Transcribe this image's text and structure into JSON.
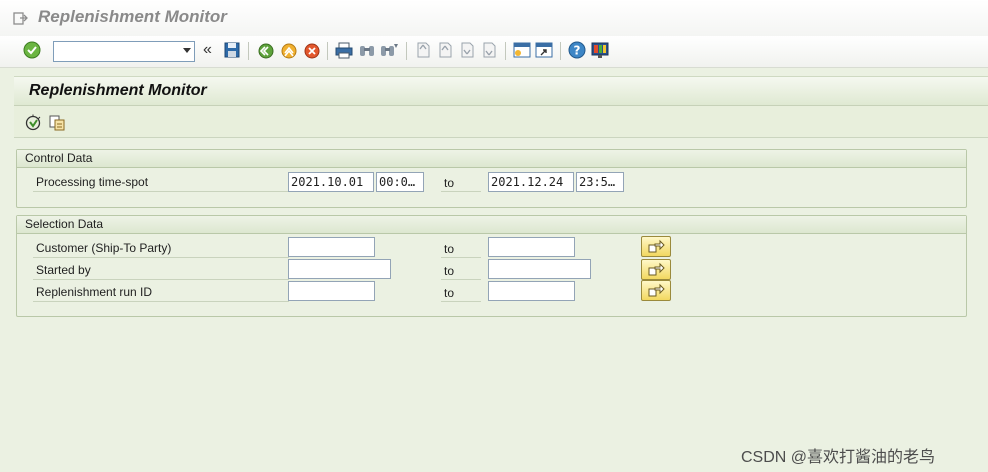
{
  "window": {
    "title": "Replenishment Monitor"
  },
  "toolbar": {
    "command_field": {
      "value": ""
    },
    "icons": [
      "enter-icon",
      "command-dropdown-icon",
      "collapse-icon",
      "save-icon",
      "back-icon",
      "exit-icon",
      "cancel-icon",
      "print-icon",
      "find-icon",
      "find-next-icon",
      "first-page-icon",
      "previous-page-icon",
      "next-page-icon",
      "last-page-icon",
      "create-session-icon",
      "shortcut-icon",
      "help-icon",
      "layout-icon"
    ]
  },
  "page": {
    "title": "Replenishment Monitor",
    "app_icons": [
      "execute-icon",
      "get-variant-icon"
    ]
  },
  "control": {
    "header": "Control Data",
    "rows": [
      {
        "label": "Processing time-spot",
        "from_date": "2021.10.01",
        "from_time": "00:0…",
        "to_label": "to",
        "to_date": "2021.12.24",
        "to_time": "23:5…"
      }
    ]
  },
  "selection": {
    "header": "Selection Data",
    "rows": [
      {
        "label": "Customer (Ship-To Party)",
        "from": "",
        "to_label": "to",
        "to": ""
      },
      {
        "label": "Started by",
        "from": "",
        "to_label": "to",
        "to": ""
      },
      {
        "label": "Replenishment run ID",
        "from": "",
        "to_label": "to",
        "to": ""
      }
    ]
  },
  "watermark": "CSDN @喜欢打酱油的老鸟",
  "colors": {
    "background": "#ebf1e2",
    "header": "#dfe9d2",
    "group_border": "#b9c8a8",
    "multi_button": "#f2d860"
  }
}
